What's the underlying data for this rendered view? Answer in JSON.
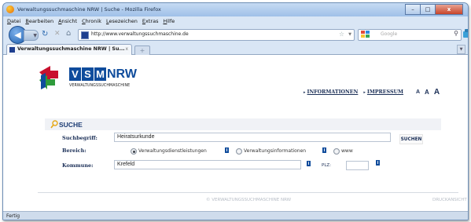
{
  "window": {
    "title": "Verwaltungssuchmaschine NRW | Suche - Mozilla Firefox",
    "controls": {
      "minimize": "–",
      "maximize": "□",
      "close": "x"
    }
  },
  "menubar": [
    "Datei",
    "Bearbeiten",
    "Ansicht",
    "Chronik",
    "Lesezeichen",
    "Extras",
    "Hilfe"
  ],
  "navbar": {
    "url": "http://www.verwaltungssuchmaschine.de",
    "search_placeholder": "Google",
    "icons": [
      "back-icon",
      "forward-icon",
      "reload-icon",
      "stop-icon",
      "home-icon",
      "star-icon",
      "search-icon"
    ]
  },
  "tab": {
    "label": "Verwaltungssuchmaschine NRW | Su...",
    "close": "x",
    "new_tab": "+"
  },
  "page": {
    "logo": {
      "letters": [
        "V",
        "S",
        "M"
      ],
      "region": "NRW",
      "subtitle": "VERWALTUNGSSUCHMASCHINE"
    },
    "topnav": {
      "links": [
        "INFORMATIONEN",
        "IMPRESSUM"
      ],
      "font_sizes": [
        "A",
        "A",
        "A"
      ]
    },
    "section_title": "SUCHE",
    "form": {
      "suchbegriff_label": "Suchbegriff:",
      "suchbegriff_value": "Heiratsurkunde",
      "bereich_label": "Bereich:",
      "bereich_options": [
        {
          "label": "Verwaltungsdienstleistungen",
          "selected": true
        },
        {
          "label": "Verwaltungsinformationen",
          "selected": false
        },
        {
          "label": "www",
          "selected": false
        }
      ],
      "kommune_label": "Kommune:",
      "kommune_value": "Krefeld",
      "plz_label": "PLZ:",
      "plz_value": "",
      "submit_label": "SUCHEN",
      "info_glyph": "i"
    },
    "footer": {
      "center": "© VERWALTUNGSSUCHMASCHINE NRW",
      "right": "DRUCKANSICHT"
    }
  },
  "statusbar": {
    "text": "Fertig"
  },
  "colors": {
    "brand_blue": "#0f4c9c",
    "nav_text": "#1b2f57",
    "window_frame": "#9fc0e8"
  }
}
